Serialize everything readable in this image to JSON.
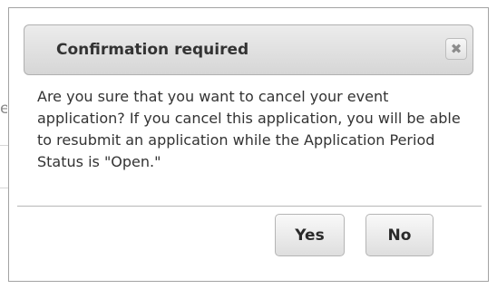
{
  "background": {
    "fragment_text": "e"
  },
  "dialog": {
    "title": "Confirmation required",
    "close_glyph": "✖",
    "message": "Are you sure that you want to cancel your event application? If you cancel this application, you will be able to resubmit an application while the Application Period Status is \"Open.\"",
    "buttons": {
      "yes_label": "Yes",
      "no_label": "No"
    }
  },
  "colors": {
    "titlebar_top": "#ececec",
    "titlebar_bottom": "#d6d6d6",
    "text": "#333333",
    "border": "#a3a3a3"
  },
  "icons": {
    "close": "close-icon"
  }
}
